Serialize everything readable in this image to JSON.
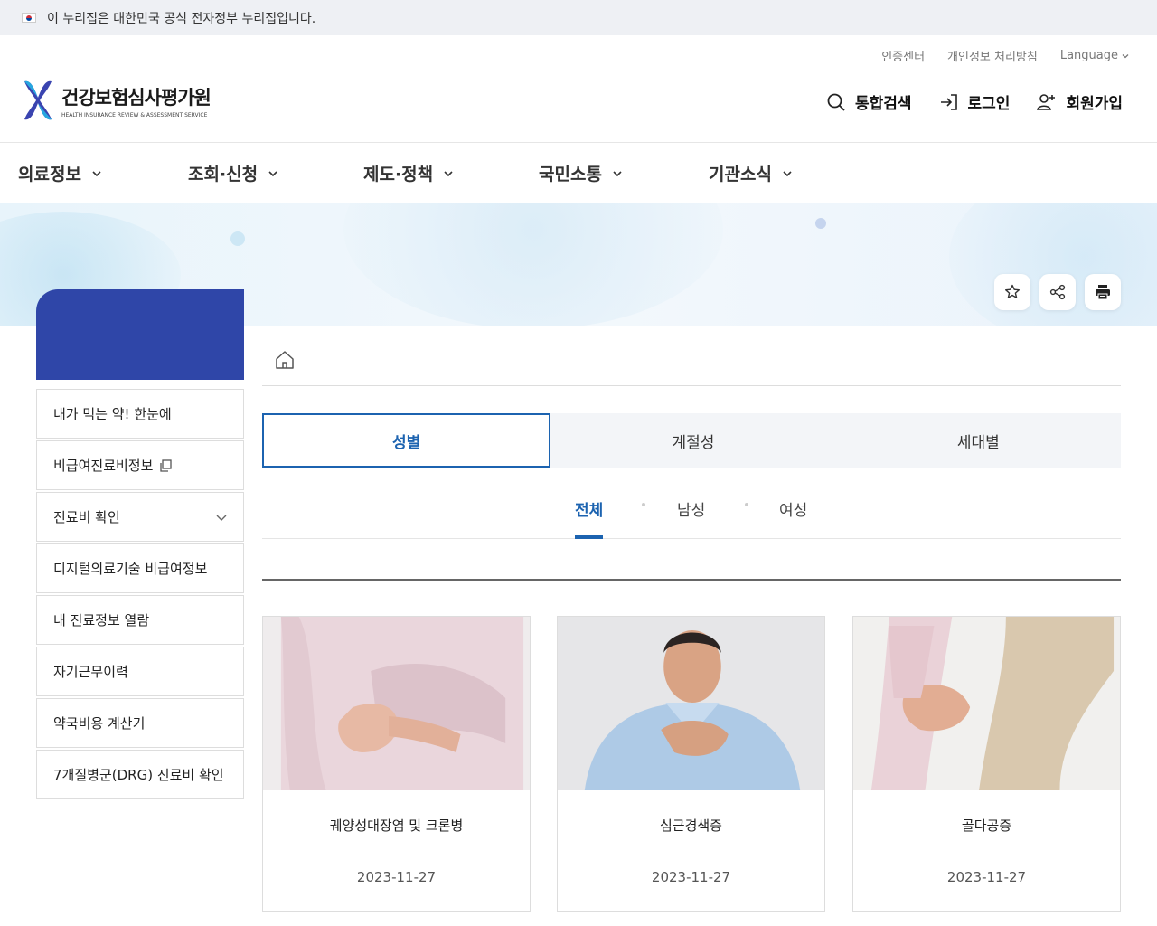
{
  "gov_banner": {
    "text": "이 누리집은 대한민국 공식 전자정부 누리집입니다."
  },
  "util_links": {
    "items": [
      "인증센터",
      "개인정보 처리방침"
    ],
    "language": "Language"
  },
  "logo": {
    "title": "건강보험심사평가원",
    "subtitle": "HEALTH INSURANCE REVIEW & ASSESSMENT SERVICE"
  },
  "top_actions": {
    "search": "통합검색",
    "login": "로그인",
    "signup": "회원가입"
  },
  "gnb": {
    "items": [
      "의료정보",
      "조회·신청",
      "제도·정책",
      "국민소통",
      "기관소식"
    ]
  },
  "sidebar": {
    "items": [
      {
        "label": "내가 먹는 약! 한눈에"
      },
      {
        "label": "비급여진료비정보"
      },
      {
        "label": "진료비 확인"
      },
      {
        "label": "디지털의료기술 비급여정보"
      },
      {
        "label": "내 진료정보 열람"
      },
      {
        "label": "자기근무이력"
      },
      {
        "label": "약국비용 계산기"
      },
      {
        "label": "7개질병군(DRG) 진료비 확인"
      }
    ]
  },
  "tabs": {
    "items": [
      "성별",
      "계절성",
      "세대별"
    ],
    "active": "성별"
  },
  "subtabs": {
    "items": [
      "전체",
      "남성",
      "여성"
    ],
    "active": "전체"
  },
  "cards": [
    {
      "title": "궤양성대장염 및 크론병",
      "date": "2023-11-27"
    },
    {
      "title": "심근경색증",
      "date": "2023-11-27"
    },
    {
      "title": "골다공증",
      "date": "2023-11-27"
    }
  ],
  "colors": {
    "brand_blue": "#2f46a8",
    "active_tab": "#1c63b0"
  }
}
